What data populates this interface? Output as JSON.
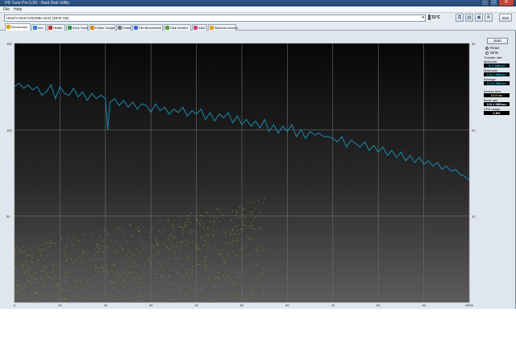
{
  "window": {
    "title": "HD Tune Pro 5.50 - Hard Disk Utility",
    "minimize": "–",
    "maximize": "□",
    "close": "✕"
  },
  "menu": {
    "file": "File",
    "help": "Help"
  },
  "toolbar": {
    "drive": "Hitachi HDS723020BLA642 (2000 GB)",
    "temperature": "31°C",
    "exit_label": "Exit"
  },
  "tabs": [
    {
      "label": "Benchmark",
      "color": "#d8a000"
    },
    {
      "label": "Info",
      "color": "#3a7ad0"
    },
    {
      "label": "Health",
      "color": "#c03030"
    },
    {
      "label": "Error Scan",
      "color": "#2a9a40"
    },
    {
      "label": "Folder Usage",
      "color": "#d08a20"
    },
    {
      "label": "Erase",
      "color": "#7a7a7a"
    },
    {
      "label": "File Benchmark",
      "color": "#3a6ad0"
    },
    {
      "label": "Disk monitor",
      "color": "#5aa030"
    },
    {
      "label": "AAM",
      "color": "#d04080"
    },
    {
      "label": "Random Access",
      "color": "#e0a020"
    }
  ],
  "side": {
    "start_label": "Start",
    "read_label": "Read",
    "write_label": "Write",
    "transfer_rate_label": "Transfer rate",
    "minimum_label": "Minimum",
    "minimum_value": "70.4 MB/sec",
    "maximum_label": "Maximum",
    "maximum_value": "143.2 MB/sec",
    "average_label": "Average",
    "average_value": "114.8 MB/sec",
    "access_time_label": "Access time",
    "access_time_value": "13.8 ms",
    "burst_rate_label": "Burst rate",
    "burst_rate_value": "118.4 MB/sec",
    "cpu_usage_label": "CPU usage",
    "cpu_usage_value": "1.8%"
  },
  "colors": {
    "transfer": "#1a8ab0",
    "access": "#a09a20",
    "cyan_value": "#1ec6e8",
    "yellow_value": "#f0d200"
  },
  "chart_data": {
    "type": "line",
    "left_axis_unit": "MB/sec",
    "left_axis_ticks": [
      "150",
      "100",
      "50"
    ],
    "right_axis_unit": "ms",
    "right_axis_ticks": [
      "30",
      "20",
      "10"
    ],
    "x_ticks": [
      "0",
      "10",
      "20",
      "30",
      "40",
      "50",
      "60",
      "70",
      "80",
      "90",
      "100%"
    ],
    "ylim": [
      0,
      150
    ],
    "xlim": [
      0,
      100
    ],
    "grid": true,
    "series": [
      {
        "key": "transfer",
        "x": [
          0,
          1,
          2,
          3,
          4,
          5,
          6,
          7,
          8,
          9,
          10,
          11,
          12,
          13,
          14,
          15,
          16,
          17,
          18,
          19,
          20,
          20.5,
          21,
          22,
          23,
          24,
          25,
          26,
          27,
          28,
          29,
          30,
          31,
          32,
          33,
          34,
          35,
          36,
          37,
          38,
          39,
          40,
          41,
          42,
          43,
          44,
          45,
          46,
          47,
          48,
          49,
          50,
          51,
          52,
          53,
          54,
          55,
          56,
          57,
          58,
          59,
          60,
          61,
          62,
          63,
          64,
          65,
          66,
          67,
          68,
          69,
          70,
          71,
          72,
          73,
          74,
          75,
          76,
          77,
          78,
          79,
          80,
          81,
          82,
          83,
          84,
          85,
          86,
          87,
          88,
          89,
          90,
          91,
          92,
          93,
          94,
          95,
          96,
          97,
          98,
          99,
          100
        ],
        "y": [
          125,
          127,
          124,
          126,
          123,
          125,
          120,
          122,
          126,
          118,
          125,
          121,
          120,
          124,
          119,
          122,
          117,
          121,
          118,
          120,
          118,
          100,
          116,
          118,
          114,
          117,
          113,
          116,
          112,
          115,
          114,
          110,
          115,
          111,
          113,
          109,
          112,
          110,
          113,
          108,
          111,
          109,
          112,
          106,
          110,
          105,
          109,
          107,
          110,
          104,
          108,
          103,
          106,
          102,
          105,
          101,
          106,
          99,
          103,
          98,
          102,
          99,
          103,
          96,
          100,
          95,
          99,
          97,
          98,
          96,
          96,
          95,
          93,
          96,
          90,
          94,
          92,
          90,
          93,
          88,
          91,
          87,
          90,
          85,
          88,
          84,
          87,
          82,
          85,
          81,
          84,
          80,
          82,
          79,
          81,
          77,
          79,
          76,
          77,
          74,
          73,
          71
        ]
      }
    ],
    "access_time_ms_range": [
      0,
      12
    ]
  }
}
